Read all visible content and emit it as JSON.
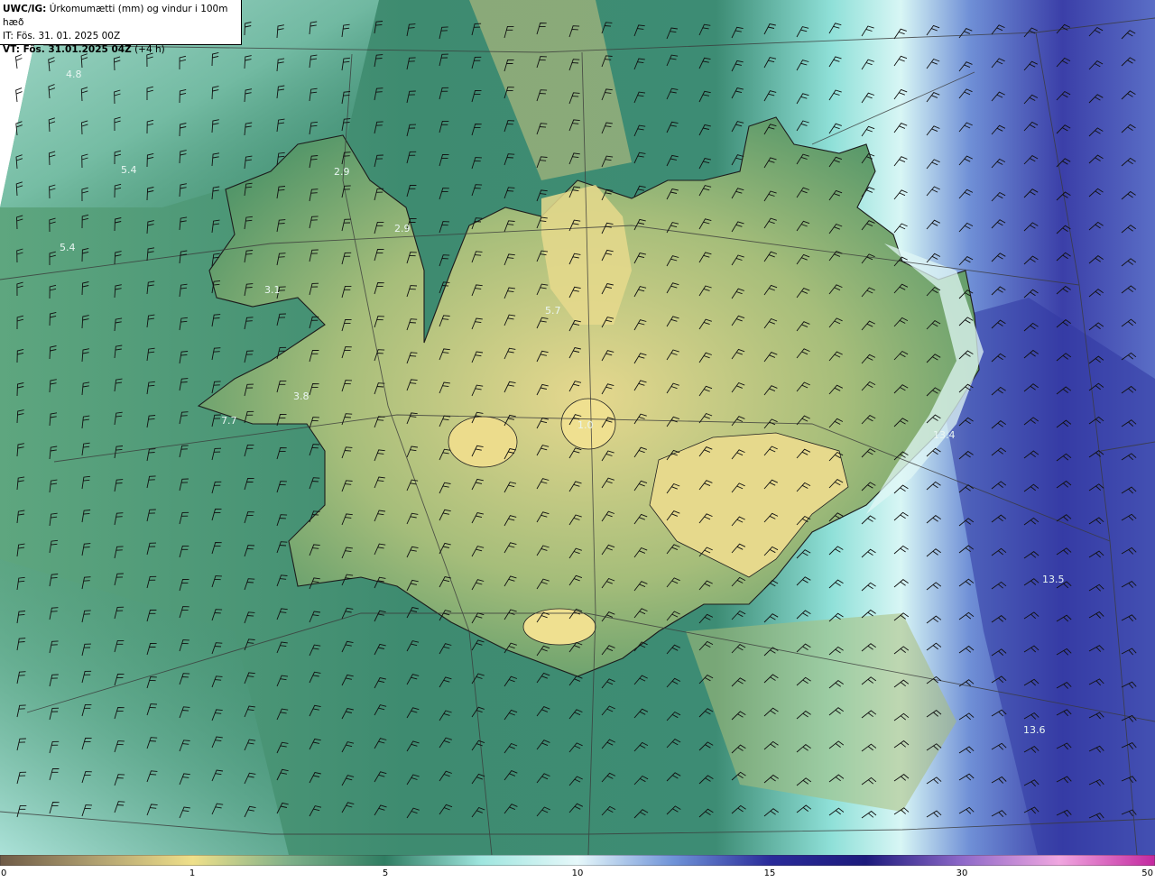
{
  "header": {
    "code": "UWC/IG:",
    "title": "Úrkomumætti (mm) og vindur i 100m hæð",
    "init_time": "IT: Fös. 31. 01. 2025 00Z",
    "valid_label": "VT: Fös. 31.01.2025 04Z",
    "valid_offset": "(+4 h)"
  },
  "colorbar": {
    "ticks": [
      "0",
      "1",
      "5",
      "10",
      "15",
      "30",
      "50"
    ],
    "stops": [
      "#6e5a46",
      "#b0a070",
      "#efe08a",
      "#7fb089",
      "#2f7d62",
      "#9fe6df",
      "#e6f8fa",
      "#6f93d8",
      "#2a2b9a",
      "#1c1a7c",
      "#8e69c9",
      "#f0a6e0",
      "#c3289f"
    ]
  },
  "map_values": [
    "4.8",
    "5.4",
    "5.4",
    "2.9",
    "2.9",
    "5.7",
    "3.1",
    "3.8",
    "7.7",
    "1.0",
    "13.4",
    "13.5",
    "13.6"
  ],
  "colors": {
    "land_yellow": "#dccf86",
    "land_green": "#5f9f6c",
    "sea_teal": "#3f8f78",
    "sea_light": "#b6ece8",
    "sea_blue": "#4a62c0",
    "sea_deep": "#2b2f9d"
  }
}
